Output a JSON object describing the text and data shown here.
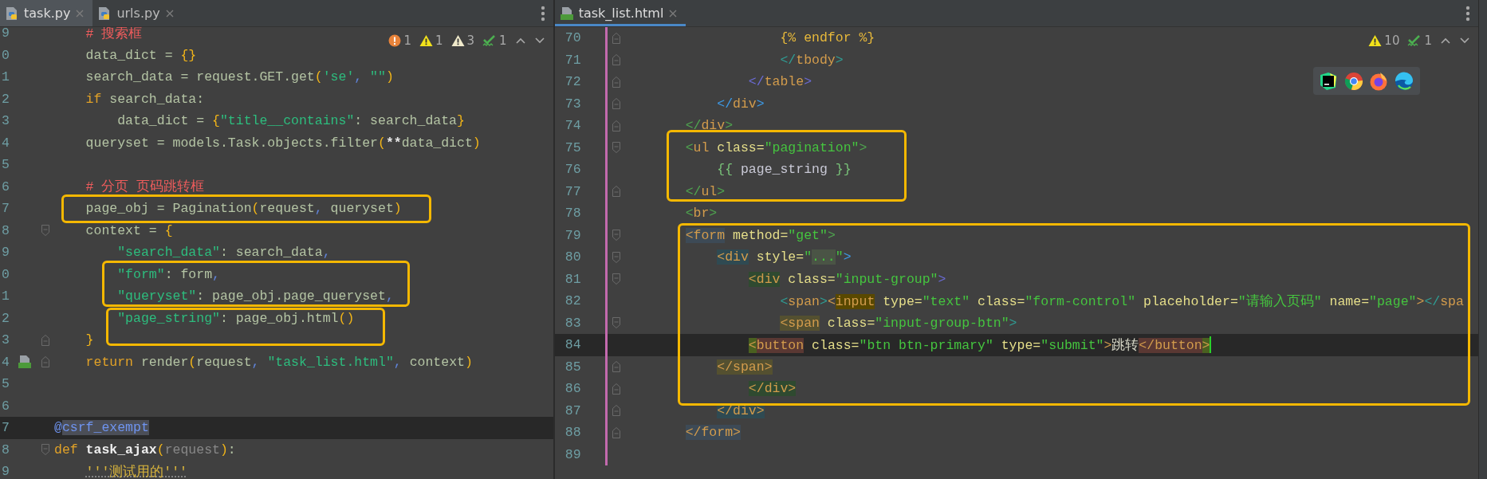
{
  "left_editor": {
    "focused": false,
    "tabs": [
      {
        "label": "task.py",
        "kind": "python",
        "selected": true
      },
      {
        "label": "urls.py",
        "kind": "python",
        "selected": false
      }
    ],
    "inspections": [
      {
        "kind": "error",
        "count": "1"
      },
      {
        "kind": "warning",
        "count": "1"
      },
      {
        "kind": "weak-warning",
        "count": "3"
      },
      {
        "kind": "typo",
        "count": "1"
      }
    ],
    "lines": [
      {
        "number": "9",
        "current": false,
        "fold_start": false,
        "fold_end": false,
        "file_marker": false,
        "tokens": [
          {
            "text": "    # 搜索框",
            "kind": "comment"
          }
        ]
      },
      {
        "number": "0",
        "current": false,
        "fold_start": false,
        "fold_end": false,
        "file_marker": false,
        "tokens": [
          {
            "text": "    data_dict = ",
            "kind": "plain"
          },
          {
            "text": "{}",
            "kind": "brace"
          }
        ]
      },
      {
        "number": "1",
        "current": false,
        "fold_start": false,
        "fold_end": false,
        "file_marker": false,
        "tokens": [
          {
            "text": "    search_data = request.GET.get",
            "kind": "plain"
          },
          {
            "text": "(",
            "kind": "brace"
          },
          {
            "text": "'se'",
            "kind": "string"
          },
          {
            "text": ", ",
            "kind": "comma"
          },
          {
            "text": "\"\"",
            "kind": "string"
          },
          {
            "text": ")",
            "kind": "brace"
          }
        ]
      },
      {
        "number": "2",
        "current": false,
        "fold_start": false,
        "fold_end": false,
        "file_marker": false,
        "tokens": [
          {
            "text": "    if",
            "kind": "keyword"
          },
          {
            "text": " search_data:",
            "kind": "plain"
          }
        ]
      },
      {
        "number": "3",
        "current": false,
        "fold_start": false,
        "fold_end": false,
        "file_marker": false,
        "tokens": [
          {
            "text": "        data_dict = ",
            "kind": "plain"
          },
          {
            "text": "{",
            "kind": "brace"
          },
          {
            "text": "\"title__contains\"",
            "kind": "string"
          },
          {
            "text": ": search_data",
            "kind": "plain"
          },
          {
            "text": "}",
            "kind": "brace"
          }
        ]
      },
      {
        "number": "4",
        "current": false,
        "fold_start": false,
        "fold_end": false,
        "file_marker": false,
        "tokens": [
          {
            "text": "    queryset = models.Task.objects.filter",
            "kind": "plain"
          },
          {
            "text": "(",
            "kind": "brace"
          },
          {
            "text": "**",
            "kind": "op"
          },
          {
            "text": "data_dict",
            "kind": "plain"
          },
          {
            "text": ")",
            "kind": "brace"
          }
        ]
      },
      {
        "number": "5",
        "current": false,
        "fold_start": false,
        "fold_end": false,
        "file_marker": false
      },
      {
        "number": "6",
        "current": false,
        "fold_start": false,
        "fold_end": false,
        "file_marker": false,
        "tokens": [
          {
            "text": "    # 分页 页码跳转框",
            "kind": "comment"
          }
        ]
      },
      {
        "number": "7",
        "current": false,
        "fold_start": false,
        "fold_end": false,
        "file_marker": false,
        "tokens": [
          {
            "text": "    page_obj = Pagination",
            "kind": "plain"
          },
          {
            "text": "(",
            "kind": "brace"
          },
          {
            "text": "request",
            "kind": "plain"
          },
          {
            "text": ", ",
            "kind": "comma"
          },
          {
            "text": "queryset",
            "kind": "plain"
          },
          {
            "text": ")",
            "kind": "brace"
          }
        ]
      },
      {
        "number": "8",
        "current": false,
        "fold_start": true,
        "fold_end": false,
        "file_marker": false,
        "tokens": [
          {
            "text": "    context = ",
            "kind": "plain"
          },
          {
            "text": "{",
            "kind": "brace"
          }
        ]
      },
      {
        "number": "9",
        "current": false,
        "fold_start": false,
        "fold_end": false,
        "file_marker": false,
        "tokens": [
          {
            "text": "        \"search_data\"",
            "kind": "string"
          },
          {
            "text": ": search_data",
            "kind": "plain"
          },
          {
            "text": ",",
            "kind": "comma"
          }
        ]
      },
      {
        "number": "0",
        "current": false,
        "fold_start": false,
        "fold_end": false,
        "file_marker": false,
        "tokens": [
          {
            "text": "        \"form\"",
            "kind": "string"
          },
          {
            "text": ": form",
            "kind": "plain"
          },
          {
            "text": ",",
            "kind": "comma"
          }
        ]
      },
      {
        "number": "1",
        "current": false,
        "fold_start": false,
        "fold_end": false,
        "file_marker": false,
        "tokens": [
          {
            "text": "        \"queryset\"",
            "kind": "string"
          },
          {
            "text": ": page_obj.page_queryset",
            "kind": "plain"
          },
          {
            "text": ",",
            "kind": "comma"
          }
        ]
      },
      {
        "number": "2",
        "current": false,
        "fold_start": false,
        "fold_end": false,
        "file_marker": false,
        "tokens": [
          {
            "text": "        \"page_string\"",
            "kind": "string"
          },
          {
            "text": ": page_obj.html",
            "kind": "plain"
          },
          {
            "text": "()",
            "kind": "brace"
          }
        ]
      },
      {
        "number": "3",
        "current": false,
        "fold_start": false,
        "fold_end": true,
        "file_marker": false,
        "tokens": [
          {
            "text": "    }",
            "kind": "brace"
          }
        ]
      },
      {
        "number": "4",
        "current": false,
        "fold_start": false,
        "fold_end": true,
        "file_marker": true,
        "tokens": [
          {
            "text": "    return",
            "kind": "keyword"
          },
          {
            "text": " render",
            "kind": "plain"
          },
          {
            "text": "(",
            "kind": "brace"
          },
          {
            "text": "request",
            "kind": "plain"
          },
          {
            "text": ", ",
            "kind": "comma"
          },
          {
            "text": "\"task_list.html\"",
            "kind": "string"
          },
          {
            "text": ", ",
            "kind": "comma"
          },
          {
            "text": "context",
            "kind": "plain"
          },
          {
            "text": ")",
            "kind": "brace"
          }
        ]
      },
      {
        "number": "5",
        "current": false,
        "fold_start": false,
        "fold_end": false,
        "file_marker": false
      },
      {
        "number": "6",
        "current": false,
        "fold_start": false,
        "fold_end": false,
        "file_marker": false
      },
      {
        "number": "7",
        "current": true,
        "fold_start": false,
        "fold_end": false,
        "file_marker": false,
        "tokens": [
          {
            "text": "@",
            "kind": "decorator"
          },
          {
            "text": "csrf_exempt",
            "kind": "decorator-match",
            "color": "#4b4e57"
          }
        ]
      },
      {
        "number": "8",
        "current": false,
        "fold_start": true,
        "fold_end": false,
        "file_marker": false,
        "tokens": [
          {
            "text": "def ",
            "kind": "keyword"
          },
          {
            "text": "task_ajax",
            "kind": "function"
          },
          {
            "text": "(",
            "kind": "brace"
          },
          {
            "text": "request",
            "kind": "param"
          },
          {
            "text": ")",
            "kind": "brace"
          },
          {
            "text": ":",
            "kind": "plain"
          }
        ]
      },
      {
        "number": "9",
        "current": false,
        "fold_start": false,
        "fold_end": false,
        "file_marker": false,
        "tokens": [
          {
            "text": "    '''测试用的'''",
            "kind": "docstring"
          }
        ]
      }
    ]
  },
  "right_editor": {
    "focused": true,
    "tabs": [
      {
        "label": "task_list.html",
        "kind": "html",
        "selected": true
      }
    ],
    "inspections": [
      {
        "kind": "warning",
        "count": "10"
      },
      {
        "kind": "typo",
        "count": "1"
      }
    ],
    "lines": [
      {
        "number": "70",
        "current": false,
        "fold_start": false,
        "fold_end": true,
        "tokens": [
          {
            "text": "            {% endfor %}",
            "kind": "template"
          }
        ]
      },
      {
        "number": "71",
        "current": false,
        "fold_start": false,
        "fold_end": true,
        "tokens": [
          {
            "text": "            </",
            "kind": "bracket",
            "color": "#2f9e95"
          },
          {
            "text": "tbody",
            "kind": "tag"
          },
          {
            "text": ">",
            "kind": "bracket",
            "color": "#2f9e95"
          }
        ]
      },
      {
        "number": "72",
        "current": false,
        "fold_start": false,
        "fold_end": true,
        "tokens": [
          {
            "text": "        </",
            "kind": "bracket",
            "color": "#6b6bd6"
          },
          {
            "text": "table",
            "kind": "tag"
          },
          {
            "text": ">",
            "kind": "bracket",
            "color": "#6b6bd6"
          }
        ]
      },
      {
        "number": "73",
        "current": false,
        "fold_start": false,
        "fold_end": true,
        "tokens": [
          {
            "text": "    </",
            "kind": "bracket",
            "color": "#3d9be9"
          },
          {
            "text": "div",
            "kind": "tag"
          },
          {
            "text": ">",
            "kind": "bracket",
            "color": "#3d9be9"
          }
        ]
      },
      {
        "number": "74",
        "current": false,
        "fold_start": false,
        "fold_end": true,
        "tokens": [
          {
            "text": "</",
            "kind": "bracket",
            "color": "#4fa64f"
          },
          {
            "text": "div",
            "kind": "tag"
          },
          {
            "text": ">",
            "kind": "bracket",
            "color": "#4fa64f"
          }
        ]
      },
      {
        "number": "75",
        "current": false,
        "fold_start": true,
        "fold_end": false,
        "tokens": [
          {
            "text": "<",
            "kind": "bracket",
            "color": "#4fa64f"
          },
          {
            "text": "ul",
            "kind": "tag"
          },
          {
            "text": " class=",
            "kind": "attr"
          },
          {
            "text": "\"pagination\"",
            "kind": "value"
          },
          {
            "text": ">",
            "kind": "bracket",
            "color": "#4fa64f"
          }
        ]
      },
      {
        "number": "76",
        "current": false,
        "fold_start": false,
        "fold_end": false,
        "tokens": [
          {
            "text": "    {{",
            "kind": "template-brace"
          },
          {
            "text": " page_string ",
            "kind": "template-var"
          },
          {
            "text": "}}",
            "kind": "template-brace"
          }
        ]
      },
      {
        "number": "77",
        "current": false,
        "fold_start": false,
        "fold_end": true,
        "tokens": [
          {
            "text": "</",
            "kind": "bracket",
            "color": "#4fa64f"
          },
          {
            "text": "ul",
            "kind": "tag"
          },
          {
            "text": ">",
            "kind": "bracket",
            "color": "#4fa64f"
          }
        ]
      },
      {
        "number": "78",
        "current": false,
        "fold_start": false,
        "fold_end": false,
        "tokens": [
          {
            "text": "<",
            "kind": "bracket",
            "color": "#4fa64f"
          },
          {
            "text": "br",
            "kind": "tag"
          },
          {
            "text": ">",
            "kind": "bracket",
            "color": "#4fa64f"
          }
        ]
      },
      {
        "number": "79",
        "current": false,
        "fold_start": true,
        "fold_end": false,
        "tokens": [
          {
            "text": "<form",
            "kind": "tag-match",
            "color": "#3d4a56"
          },
          {
            "text": " method=",
            "kind": "attr"
          },
          {
            "text": "\"get\"",
            "kind": "value"
          },
          {
            "text": ">",
            "kind": "bracket",
            "color": "#4fa64f"
          }
        ]
      },
      {
        "number": "80",
        "current": false,
        "fold_start": true,
        "fold_end": false,
        "tokens": [
          {
            "text": "    <div",
            "kind": "tag-match",
            "color": "#2f4a52"
          },
          {
            "text": " style=",
            "kind": "attr"
          },
          {
            "text": "\"",
            "kind": "value"
          },
          {
            "text": "...",
            "kind": "value-match",
            "color": "#4a5445"
          },
          {
            "text": "\"",
            "kind": "value"
          },
          {
            "text": ">",
            "kind": "bracket",
            "color": "#3d9be9"
          }
        ]
      },
      {
        "number": "81",
        "current": false,
        "fold_start": true,
        "fold_end": false,
        "tokens": [
          {
            "text": "        <div",
            "kind": "tag-match",
            "color": "#2f4a30"
          },
          {
            "text": " class=",
            "kind": "attr"
          },
          {
            "text": "\"input-group\"",
            "kind": "value"
          },
          {
            "text": ">",
            "kind": "bracket",
            "color": "#6b6bd6"
          }
        ]
      },
      {
        "number": "82",
        "current": false,
        "fold_start": false,
        "fold_end": false,
        "tokens": [
          {
            "text": "            <",
            "kind": "bracket",
            "color": "#2f9e95"
          },
          {
            "text": "span",
            "kind": "tag"
          },
          {
            "text": ">",
            "kind": "bracket",
            "color": "#2f9e95"
          },
          {
            "text": "<",
            "kind": "bracket",
            "color": "#d39c4c"
          },
          {
            "text": "input",
            "kind": "tag-match",
            "color": "#594800"
          },
          {
            "text": " type=",
            "kind": "attr"
          },
          {
            "text": "\"text\"",
            "kind": "value"
          },
          {
            "text": " class=",
            "kind": "attr"
          },
          {
            "text": "\"form-control\"",
            "kind": "value"
          },
          {
            "text": " placeholder=",
            "kind": "attr"
          },
          {
            "text": "\"请输入页码\"",
            "kind": "value"
          },
          {
            "text": " name=",
            "kind": "attr"
          },
          {
            "text": "\"page\"",
            "kind": "value"
          },
          {
            "text": ">",
            "kind": "bracket",
            "color": "#d39c4c"
          },
          {
            "text": "</",
            "kind": "bracket",
            "color": "#2f9e95"
          },
          {
            "text": "spa",
            "kind": "tag"
          }
        ]
      },
      {
        "number": "83",
        "current": false,
        "fold_start": true,
        "fold_end": false,
        "tokens": [
          {
            "text": "            <span",
            "kind": "tag-match",
            "color": "#545030"
          },
          {
            "text": " class=",
            "kind": "attr"
          },
          {
            "text": "\"input-group-btn\"",
            "kind": "value"
          },
          {
            "text": ">",
            "kind": "bracket",
            "color": "#2f9e95"
          }
        ]
      },
      {
        "number": "84",
        "current": true,
        "caret": true,
        "fold_start": false,
        "fold_end": false,
        "tokens": [
          {
            "text": "        <",
            "kind": "bracket-match",
            "color": "#4a6020"
          },
          {
            "text": "button",
            "kind": "tag-match",
            "color": "#5a3833"
          },
          {
            "text": " class=",
            "kind": "attr"
          },
          {
            "text": "\"btn btn-primary\"",
            "kind": "value"
          },
          {
            "text": " type=",
            "kind": "attr"
          },
          {
            "text": "\"submit\"",
            "kind": "value"
          },
          {
            "text": ">",
            "kind": "bracket",
            "color": "#d39c4c"
          },
          {
            "text": "跳转",
            "kind": "html"
          },
          {
            "text": "</button",
            "kind": "tag-match",
            "color": "#5a3833"
          },
          {
            "text": ">",
            "kind": "bracket-match",
            "color": "#4a6020"
          }
        ]
      },
      {
        "number": "85",
        "current": false,
        "fold_start": false,
        "fold_end": true,
        "tokens": [
          {
            "text": "    </span>",
            "kind": "tag-match",
            "color": "#545030"
          }
        ]
      },
      {
        "number": "86",
        "current": false,
        "fold_start": false,
        "fold_end": true,
        "tokens": [
          {
            "text": "        </div>",
            "kind": "tag-match",
            "color": "#2f4a30"
          }
        ]
      },
      {
        "number": "87",
        "current": false,
        "fold_start": false,
        "fold_end": true,
        "tokens": [
          {
            "text": "    </div>",
            "kind": "tag-match",
            "color": "#2f4a52"
          }
        ]
      },
      {
        "number": "88",
        "current": false,
        "fold_start": false,
        "fold_end": true,
        "tokens": [
          {
            "text": "</form>",
            "kind": "tag-match",
            "color": "#3d4a56"
          }
        ]
      },
      {
        "number": "89",
        "current": false,
        "fold_start": false,
        "fold_end": false
      }
    ]
  }
}
